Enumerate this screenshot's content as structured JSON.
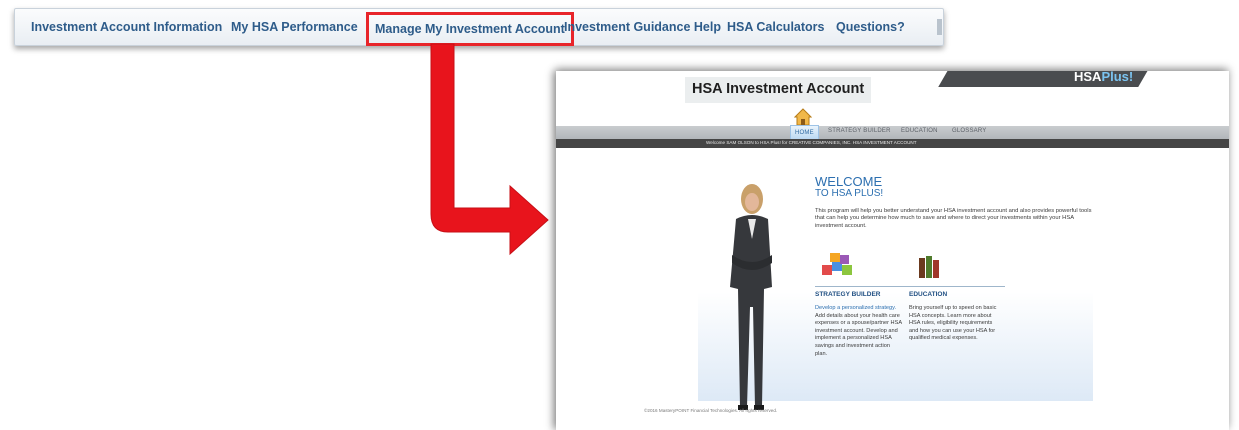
{
  "top_nav": {
    "items": [
      {
        "label": "Investment Account Information"
      },
      {
        "label": "My HSA Performance"
      },
      {
        "label": "Manage My Investment Account",
        "highlighted": true
      },
      {
        "label": "Investment Guidance Help"
      },
      {
        "label": "HSA Calculators"
      },
      {
        "label": "Questions?"
      }
    ]
  },
  "colors": {
    "highlight": "#e8252a",
    "arrow": "#e8141c",
    "nav_text": "#2e5c8a"
  },
  "screenshot": {
    "title": "HSA Investment Account",
    "logo": {
      "part1": "HSA",
      "part2": "Plus!"
    },
    "menu": [
      "HOME",
      "STRATEGY BUILDER",
      "EDUCATION",
      "GLOSSARY"
    ],
    "active_menu": "HOME",
    "welcome_bar": "Welcome SAM OLSON to HSA Plus! for CREATIVE COMPANIES, INC. HSA INVESTMENT ACCOUNT",
    "heading1": "WELCOME",
    "heading2": "TO HSA PLUS!",
    "intro": "This program will help you better understand your HSA investment account and also provides powerful tools that can help you determine how much to save and where to direct your investments within your HSA investment account.",
    "strategy": {
      "title": "STRATEGY BUILDER",
      "link": "Develop a personalized strategy.",
      "body": " Add details about your health care expenses or a spouse/partner HSA investment account. Develop and implement a personalized HSA savings and investment action plan."
    },
    "education": {
      "title": "EDUCATION",
      "body": "Bring yourself up to speed on basic HSA concepts. Learn more about HSA rules, eligibility requirements and how you can use your HSA for qualified medical expenses."
    },
    "footer": "©2016 MasteryPOINT Financial Technologies. All rights reserved."
  }
}
